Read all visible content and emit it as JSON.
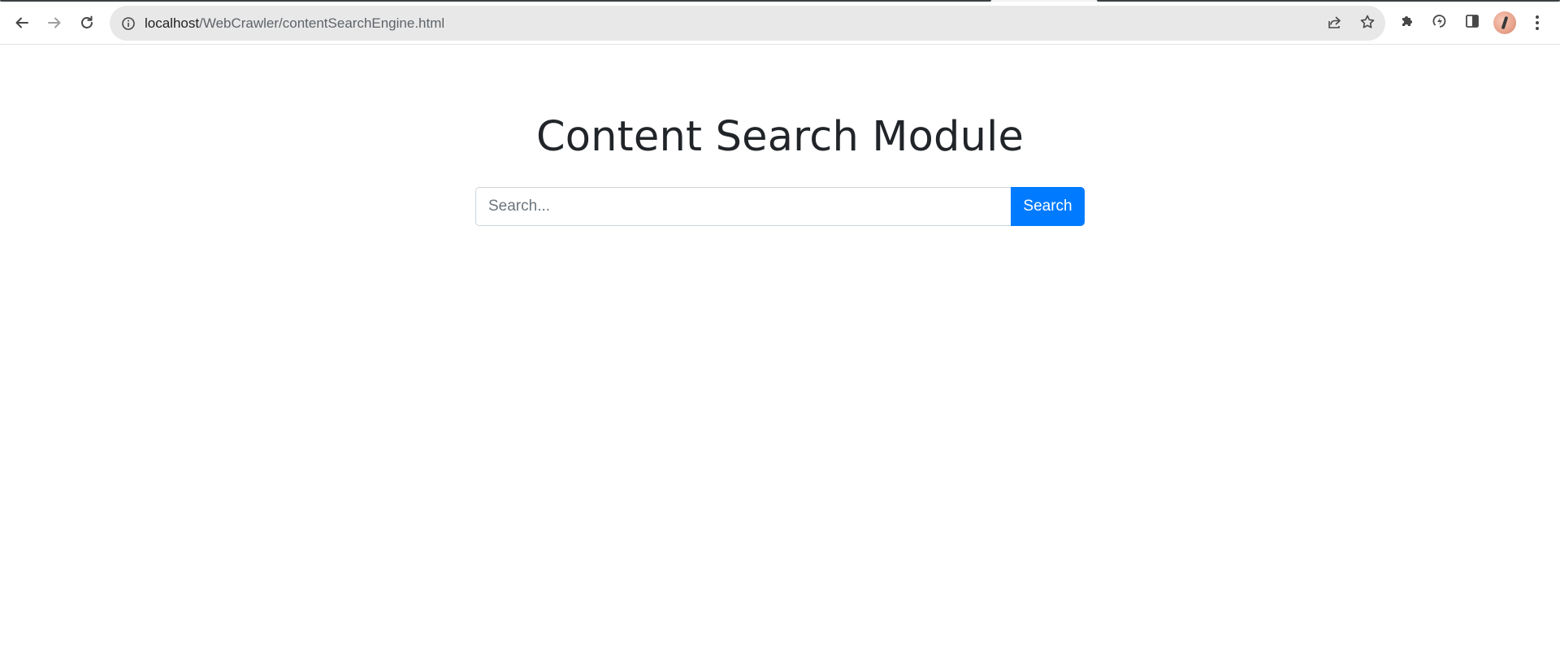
{
  "browser": {
    "url_host": "localhost",
    "url_path": "/WebCrawler/contentSearchEngine.html",
    "icons": {
      "back": "arrow-left-icon",
      "forward": "arrow-right-icon",
      "reload": "reload-icon",
      "site_info": "info-icon",
      "share": "share-icon",
      "bookmark": "star-icon",
      "extensions": "puzzle-icon",
      "extension_app": "circular-bolt-icon",
      "side_panel": "side-panel-icon",
      "profile": "avatar",
      "menu": "kebab-menu-icon"
    }
  },
  "page": {
    "title": "Content Search Module",
    "search": {
      "placeholder": "Search...",
      "value": "",
      "button_label": "Search"
    }
  },
  "colors": {
    "primary": "#007bff",
    "heading": "#212529",
    "omnibox_bg": "#e8e8e8",
    "input_border": "#ced4da"
  }
}
